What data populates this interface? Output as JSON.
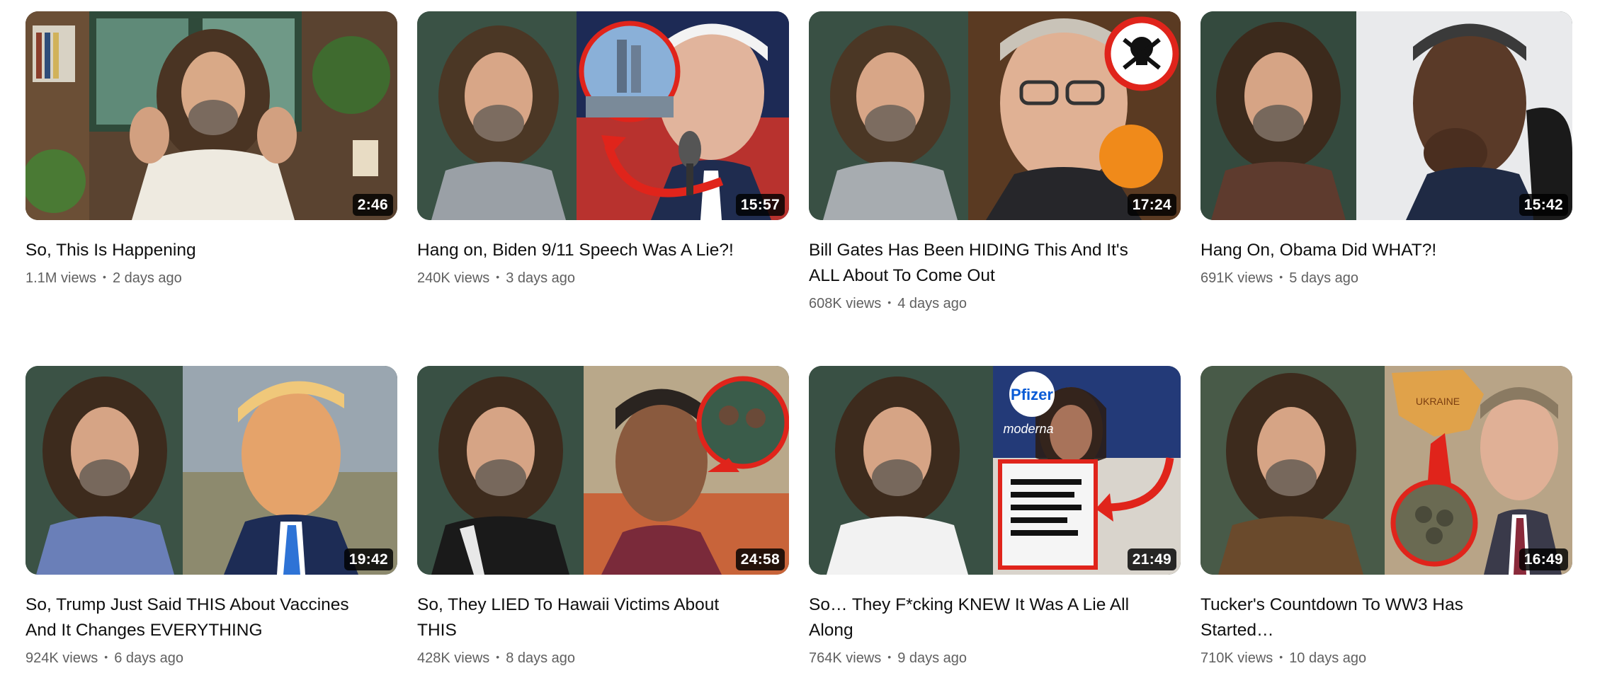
{
  "videos": [
    {
      "title": "So, This Is Happening",
      "duration": "2:46",
      "views": "1.1M views",
      "age": "2 days ago"
    },
    {
      "title": "Hang on, Biden 9/11 Speech Was A Lie?!",
      "duration": "15:57",
      "views": "240K views",
      "age": "3 days ago"
    },
    {
      "title": "Bill Gates Has Been HIDING This And It's ALL About To Come Out",
      "duration": "17:24",
      "views": "608K views",
      "age": "4 days ago"
    },
    {
      "title": "Hang On, Obama Did WHAT?!",
      "duration": "15:42",
      "views": "691K views",
      "age": "5 days ago"
    },
    {
      "title": "So, Trump Just Said THIS About Vaccines And It Changes EVERYTHING",
      "duration": "19:42",
      "views": "924K views",
      "age": "6 days ago"
    },
    {
      "title": "So, They LIED To Hawaii Victims About THIS",
      "duration": "24:58",
      "views": "428K views",
      "age": "8 days ago"
    },
    {
      "title": "So… They F*cking KNEW It Was A Lie All Along",
      "duration": "21:49",
      "views": "764K views",
      "age": "9 days ago"
    },
    {
      "title": "Tucker's Countdown To WW3 Has Started…",
      "duration": "16:49",
      "views": "710K views",
      "age": "10 days ago"
    }
  ],
  "separator": "•",
  "thumbnail_text": {
    "pfizer": "Pfizer",
    "moderna": "moderna",
    "ukraine": "UKRAINE"
  },
  "colors": {
    "title": "#0f0f0f",
    "meta": "#606060",
    "duration_bg": "#000000",
    "accent_red": "#e0241b"
  }
}
